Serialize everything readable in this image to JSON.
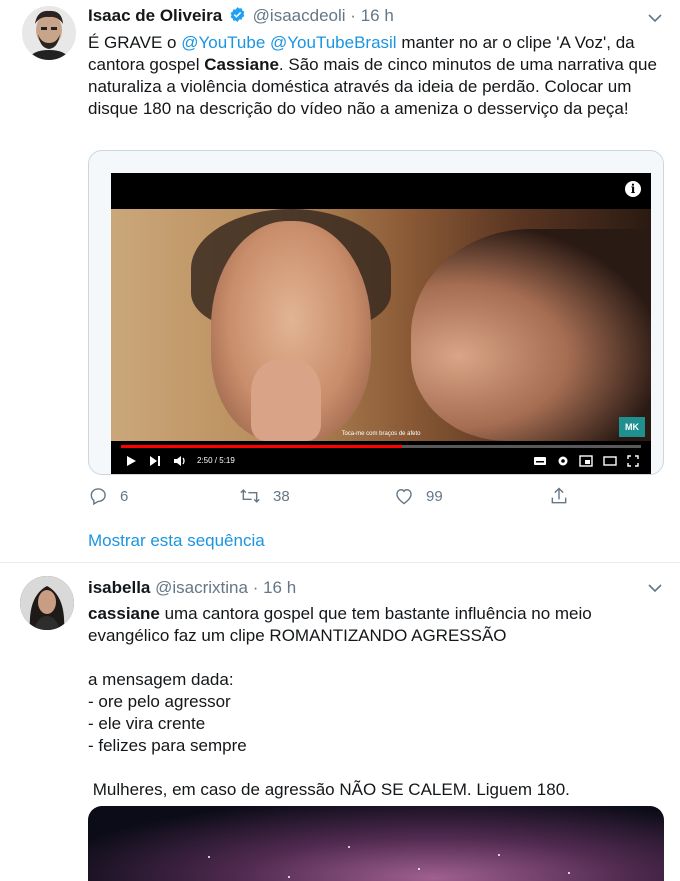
{
  "tweets": [
    {
      "author_name": "Isaac de Oliveira",
      "handle": "@isaacdeoli",
      "separator": "·",
      "time": "16 h",
      "verified": true,
      "text_parts": [
        "É GRAVE o ",
        "@YouTube",
        " ",
        "@YouTubeBrasil",
        " manter no ar o clipe 'A Voz', da cantora gospel ",
        "Cassiane",
        ". São mais de cinco minutos de uma narrativa que naturaliza a violência doméstica através da ideia de perdão. Colocar um disque 180 na descrição do vídeo não a ameniza o desserviço da peça!"
      ],
      "video": {
        "subtitle": "Toca-me com braços de afeto",
        "logo": "MK",
        "time_readout": "2:50 / 5:19",
        "progress": 0.54
      },
      "actions": {
        "reply_count": "6",
        "retweet_count": "38",
        "like_count": "99"
      },
      "show_thread": "Mostrar esta sequência"
    },
    {
      "author_name": "isabella",
      "handle": "@isacrixtina",
      "separator": "·",
      "time": "16 h",
      "verified": false,
      "line1_bold": "cassiane",
      "line1_rest": " uma cantora gospel que tem bastante influência no meio evangélico faz um clipe ROMANTIZANDO AGRESSÃO",
      "line2": "a mensagem dada:",
      "line3": "- ore pelo agressor",
      "line4": "- ele vira crente",
      "line5": "- felizes para sempre",
      "line6": " Mulheres, em caso de agressão NÃO SE CALEM. Liguem 180."
    }
  ],
  "colors": {
    "link": "#1b95e0",
    "muted": "#657786",
    "text": "#14171a",
    "verified": "#1da1f2"
  },
  "icons": [
    "verified-icon",
    "chevron-down-icon",
    "reply-icon",
    "retweet-icon",
    "like-icon",
    "share-icon",
    "info-icon",
    "play-icon",
    "next-icon",
    "volume-icon",
    "settings-icon",
    "fullscreen-icon"
  ]
}
